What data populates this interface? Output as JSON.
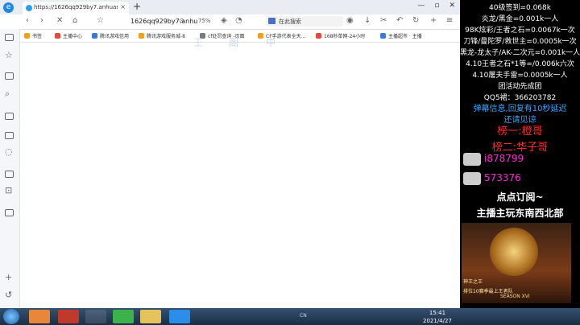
{
  "browser": {
    "tab_title": "https://1626qq929by7.anhuang.n",
    "tab_close": "×",
    "new_tab": "+",
    "address": "1626qq929by7.anhu",
    "zoom": "75%",
    "search_label": "在此搜索",
    "window_buttons": [
      "—",
      "▫",
      "✕"
    ],
    "bookmarks": [
      {
        "label": "书签",
        "color": "#f0a020"
      },
      {
        "label": "主播中心",
        "color": "#e64a3c"
      },
      {
        "label": "腾讯游戏信用",
        "color": "#3b78d8"
      },
      {
        "label": "腾讯游戏服务城-8",
        "color": "#f0a020"
      },
      {
        "label": "cf处罚查询 -页面",
        "color": "#7a7a7a"
      },
      {
        "label": "CF手游代表全天...",
        "color": "#f0a020"
      },
      {
        "label": "168秒单网-24小时",
        "color": "#e64a3c"
      },
      {
        "label": "主播超市 · 主播",
        "color": "#3b78d8"
      }
    ],
    "watermark": [
      "王",
      "阁",
      "中"
    ]
  },
  "taskbar": {
    "clock_time": "15:41",
    "clock_date": "2021/4/27",
    "lang": "CN"
  },
  "overlay": {
    "lines": [
      {
        "text": "40级签到=0.068k",
        "color": "#ffffff"
      },
      {
        "text": "炎龙/黑金=0.001k一人",
        "color": "#ffffff"
      },
      {
        "text": "98K炫彩/王者之石=0.0067k一次",
        "color": "#ffffff"
      },
      {
        "text": "刀锋/曼陀罗/救世主=0.0005k一次",
        "color": "#ffffff"
      },
      {
        "text": "黑龙-龙太子/AK-二次元=0.001k一人",
        "color": "#ffffff"
      },
      {
        "text": "4.10王者之石*1等=/0.006k六次",
        "color": "#ffffff"
      },
      {
        "text": "4.10屠夫手雷=0.0005k一人",
        "color": "#ffffff"
      },
      {
        "text": "团活动先成团",
        "color": "#ffffff"
      },
      {
        "text": "QQ5裙：366203782",
        "color": "#ffffff"
      },
      {
        "text": "弹幕信息,回复有10秒延迟",
        "color": "#3aa8ff"
      },
      {
        "text": "还请见谅",
        "color": "#3aa8ff"
      },
      {
        "text": "榜一:橙哥",
        "color": "#ff2b2b"
      },
      {
        "text": "榜二:华子哥",
        "color": "#ff2b2b"
      },
      {
        "text": "i878799",
        "color": "#ff2bd6"
      },
      {
        "text": "573376",
        "color": "#ff2bd6"
      },
      {
        "text": "点点订阅~",
        "color": "#ffffff"
      },
      {
        "text": "主播主玩东南西北部",
        "color": "#ffffff"
      }
    ],
    "image_caption_1": "神王之王",
    "image_caption_2": "排位10赛季最上王者队",
    "image_caption_3": "SEASON XVI"
  }
}
